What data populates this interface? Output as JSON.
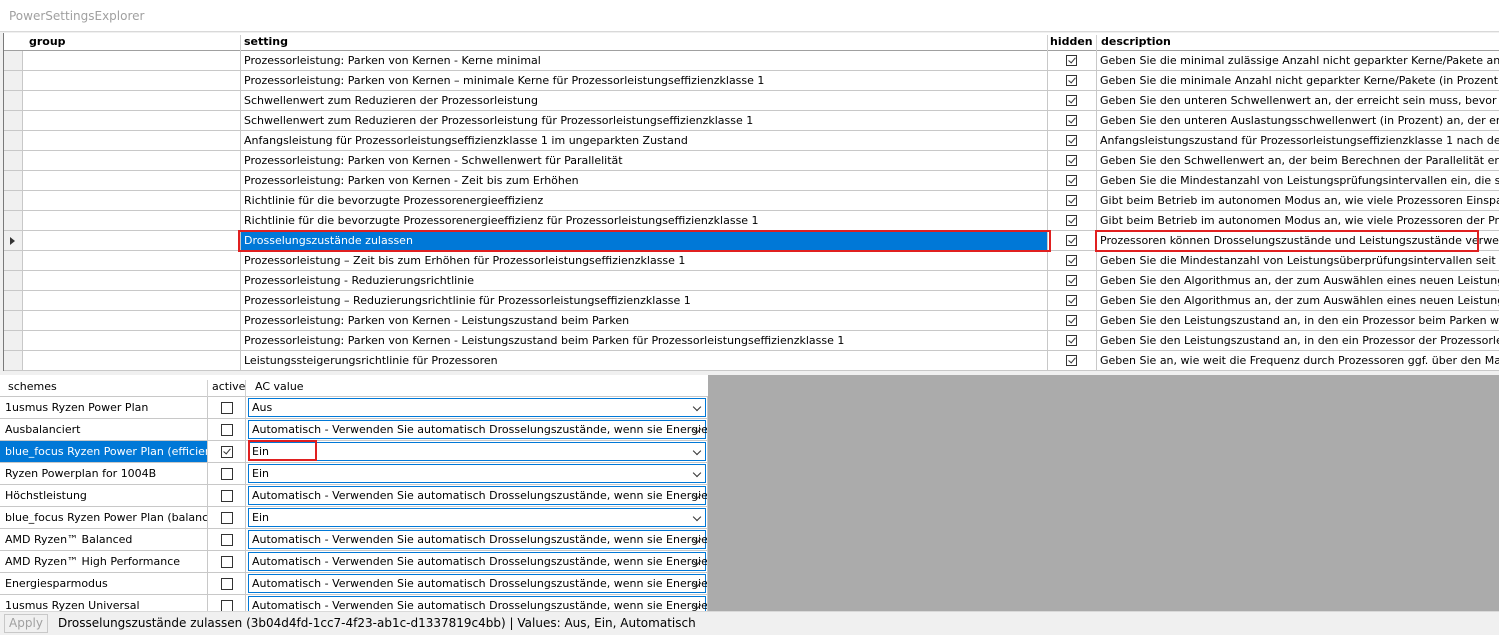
{
  "window": {
    "title": "PowerSettingsExplorer"
  },
  "settings_grid": {
    "columns": {
      "group": "group",
      "setting": "setting",
      "hidden": "hidden",
      "description": "description"
    },
    "rows": [
      {
        "group": "",
        "setting": "Prozessorleistung: Parken von Kernen - Kerne minimal",
        "hidden": true,
        "description": "Geben Sie die minimal zulässige Anzahl nicht geparkter Kerne/Pakete an (in Prozent)"
      },
      {
        "group": "",
        "setting": "Prozessorleistung: Parken von Kernen – minimale Kerne für Prozessorleistungseffizienzklasse 1",
        "hidden": true,
        "description": "Geben Sie die minimale Anzahl nicht geparkter Kerne/Pakete (in Prozent) an, die für P"
      },
      {
        "group": "",
        "setting": "Schwellenwert zum Reduzieren der Prozessorleistung",
        "hidden": true,
        "description": "Geben Sie den unteren Schwellenwert an, der erreicht sein muss, bevor die Leistung"
      },
      {
        "group": "",
        "setting": "Schwellenwert zum Reduzieren der Prozessorleistung für Prozessorleistungseffizienzklasse 1",
        "hidden": true,
        "description": "Geben Sie den unteren Auslastungsschwellenwert (in Prozent) an, der erreicht sein mu"
      },
      {
        "group": "",
        "setting": "Anfangsleistung für Prozessorleistungseffizienzklasse 1 im ungeparkten Zustand",
        "hidden": true,
        "description": "Anfangsleistungszustand für Prozessorleistungseffizienzklasse 1 nach dem Zurückhole"
      },
      {
        "group": "",
        "setting": "Prozessorleistung: Parken von Kernen - Schwellenwert für Parallelität",
        "hidden": true,
        "description": "Geben Sie den Schwellenwert an, der beim Berechnen der Parallelität erreicht werden"
      },
      {
        "group": "",
        "setting": "Prozessorleistung: Parken von Kernen - Zeit bis zum Erhöhen",
        "hidden": true,
        "description": "Geben Sie die Mindestanzahl von Leistungsprüfungsintervallen ein, die stattfinden mü"
      },
      {
        "group": "",
        "setting": "Richtlinie für die bevorzugte Prozessorenergieeffizienz",
        "hidden": true,
        "description": "Gibt beim Betrieb im autonomen Modus an, wie viele Prozessoren Einsparungen den V"
      },
      {
        "group": "",
        "setting": "Richtlinie für die bevorzugte Prozessorenergieeffizienz für Prozessorleistungseffizienzklasse 1",
        "hidden": true,
        "description": "Gibt beim Betrieb im autonomen Modus an, wie viele Prozessoren der Prozessorleistu"
      },
      {
        "group": "",
        "setting": "Drosselungszustände zulassen",
        "hidden": true,
        "description": "Prozessoren können Drosselungszustände und Leistungszustände verwenden.",
        "selected": true
      },
      {
        "group": "",
        "setting": "Prozessorleistung – Zeit bis zum Erhöhen für Prozessorleistungseffizienzklasse 1",
        "hidden": true,
        "description": "Geben Sie die Mindestanzahl von Leistungsüberprüfungsintervallen seit der letzten Le"
      },
      {
        "group": "",
        "setting": "Prozessorleistung - Reduzierungsrichtlinie",
        "hidden": true,
        "description": "Geben Sie den Algorithmus an, der zum Auswählen eines neuen Leistungsstatus verw"
      },
      {
        "group": "",
        "setting": "Prozessorleistung – Reduzierungsrichtlinie für Prozessorleistungseffizienzklasse 1",
        "hidden": true,
        "description": "Geben Sie den Algorithmus an, der zum Auswählen eines neuen Leistungszustands v"
      },
      {
        "group": "",
        "setting": "Prozessorleistung: Parken von Kernen - Leistungszustand beim Parken",
        "hidden": true,
        "description": "Geben Sie den Leistungszustand an, in den ein Prozessor beim Parken wechselt."
      },
      {
        "group": "",
        "setting": "Prozessorleistung: Parken von Kernen - Leistungszustand beim Parken für Prozessorleistungseffizienzklasse 1",
        "hidden": true,
        "description": "Geben Sie den Leistungszustand an, in den ein Prozessor der Prozessorleistungseffizi"
      },
      {
        "group": "",
        "setting": "Leistungssteigerungsrichtlinie für Prozessoren",
        "hidden": true,
        "description": "Geben Sie an, wie weit die Frequenz durch Prozessoren ggf. über den Maximalwert hi"
      }
    ]
  },
  "schemes_grid": {
    "columns": {
      "scheme": "schemes",
      "active": "active",
      "ac_value": "AC value"
    },
    "rows": [
      {
        "scheme": "1usmus Ryzen Power Plan",
        "active": false,
        "ac_value": "Aus"
      },
      {
        "scheme": "Ausbalanciert",
        "active": false,
        "ac_value": "Automatisch - Verwenden Sie automatisch Drosselungszustände, wenn sie Energie sparen."
      },
      {
        "scheme": "blue_focus Ryzen Power Plan (efficient)",
        "active": true,
        "ac_value": "Ein",
        "selected": true
      },
      {
        "scheme": "Ryzen Powerplan for 1004B",
        "active": false,
        "ac_value": "Ein"
      },
      {
        "scheme": "Höchstleistung",
        "active": false,
        "ac_value": "Automatisch - Verwenden Sie automatisch Drosselungszustände, wenn sie Energie sparen."
      },
      {
        "scheme": "blue_focus Ryzen Power Plan (balanced)",
        "active": false,
        "ac_value": "Ein"
      },
      {
        "scheme": "AMD Ryzen™ Balanced",
        "active": false,
        "ac_value": "Automatisch - Verwenden Sie automatisch Drosselungszustände, wenn sie Energie sparen."
      },
      {
        "scheme": "AMD Ryzen™ High Performance",
        "active": false,
        "ac_value": "Automatisch - Verwenden Sie automatisch Drosselungszustände, wenn sie Energie sparen."
      },
      {
        "scheme": "Energiesparmodus",
        "active": false,
        "ac_value": "Automatisch - Verwenden Sie automatisch Drosselungszustände, wenn sie Energie sparen."
      },
      {
        "scheme": "1usmus Ryzen Universal",
        "active": false,
        "ac_value": "Automatisch - Verwenden Sie automatisch Drosselungszustände, wenn sie Energie sparen."
      }
    ]
  },
  "status_bar": {
    "apply_label": "Apply",
    "text": "Drosselungszustände zulassen (3b04d4fd-1cc7-4f23-ab1c-d1337819c4bb) | Values: Aus, Ein, Automatisch"
  },
  "colors": {
    "selection": "#0078d7",
    "highlight_border": "#e02020"
  }
}
